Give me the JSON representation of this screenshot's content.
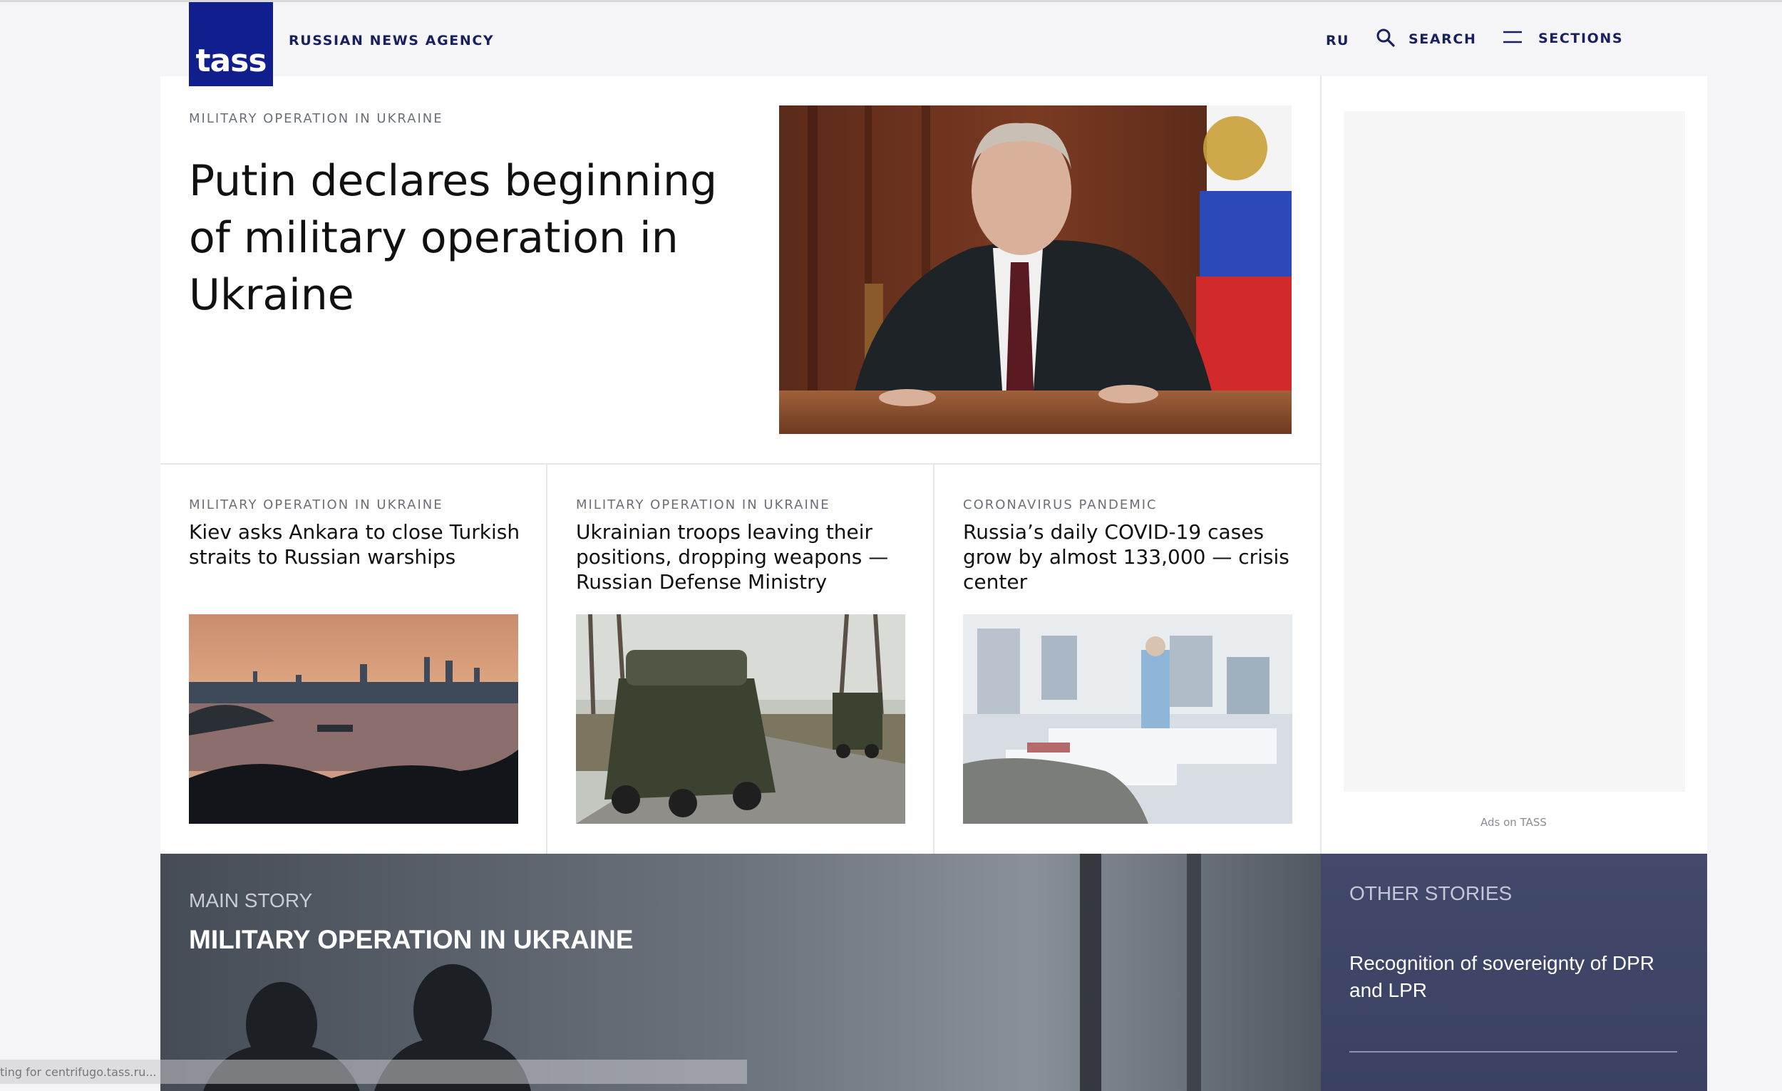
{
  "header": {
    "logo_text": "TASS",
    "agency_name": "RUSSIAN NEWS AGENCY",
    "lang_link": "RU",
    "search_label": "SEARCH",
    "sections_label": "SECTIONS",
    "icons": {
      "search": "search-icon",
      "sections": "menu-icon"
    }
  },
  "lead_story": {
    "rubric": "MILITARY OPERATION IN UKRAINE",
    "title": "Putin declares beginning of military operation in Ukraine",
    "image": "photo-man-at-desk-with-flag"
  },
  "cards": [
    {
      "rubric": "MILITARY OPERATION IN UKRAINE",
      "title": "Kiev asks Ankara to close Turkish straits to Russian warships",
      "image": "photo-city-strait-sunset"
    },
    {
      "rubric": "MILITARY OPERATION IN UKRAINE",
      "title": "Ukrainian troops leaving their positions, dropping weapons — Russian Defense Ministry",
      "image": "photo-military-vehicles-road"
    },
    {
      "rubric": "CORONAVIRUS PANDEMIC",
      "title": "Russia’s daily COVID-19 cases grow by almost 133,000 — crisis center",
      "image": "photo-hospital-icu"
    }
  ],
  "ads": {
    "label": "Ads on TASS"
  },
  "main_story": {
    "label": "MAIN STORY",
    "title": "MILITARY OPERATION IN UKRAINE"
  },
  "other_stories": {
    "label": "OTHER STORIES",
    "items": [
      "Recognition of sovereignty of DPR and LPR"
    ]
  },
  "status_bar": {
    "text": "ting for centrifugo.tass.ru..."
  },
  "colors": {
    "brand": "#101e8e",
    "nav_text": "#18205e",
    "other_bg": "#3f4667"
  }
}
